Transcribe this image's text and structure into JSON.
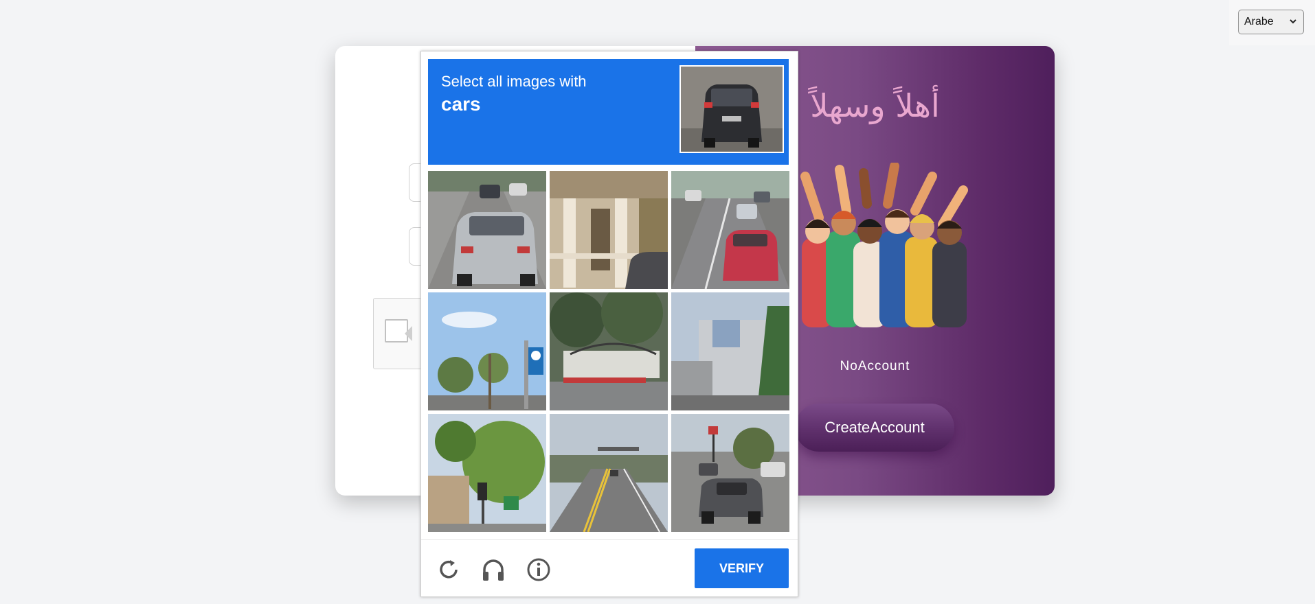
{
  "language_select": {
    "selected": "Arabe"
  },
  "right_panel": {
    "welcome_text": "أهلاً وسهلاً",
    "no_account_text": "NoAccount",
    "create_account_label": "CreateAccount"
  },
  "captcha": {
    "instruction": "Select all images with",
    "target_word": "cars",
    "verify_label": "VERIFY",
    "footer_icons": [
      "refresh-icon",
      "headphones-icon",
      "info-icon"
    ],
    "tiles": [
      {
        "scene": "highway traffic with silver car"
      },
      {
        "scene": "house porch with columns"
      },
      {
        "scene": "city street with cars and red car"
      },
      {
        "scene": "trees and sky with sign pole"
      },
      {
        "scene": "fence with hedges"
      },
      {
        "scene": "building with tree"
      },
      {
        "scene": "tree with traffic light"
      },
      {
        "scene": "road with yellow lines"
      },
      {
        "scene": "road with pickup truck"
      }
    ]
  },
  "colors": {
    "captcha_blue": "#1a73e8",
    "panel_purple": "#5e2b68",
    "welcome_pink": "#e9a7cf"
  }
}
